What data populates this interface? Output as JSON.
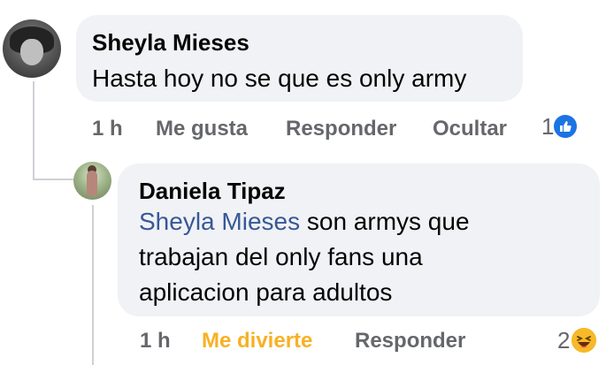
{
  "comment": {
    "author": "Sheyla Mieses",
    "text": "Hasta hoy no se que es only army",
    "time": "1 h",
    "like_label": "Me gusta",
    "reply_label": "Responder",
    "hide_label": "Ocultar",
    "reaction_count": "1",
    "reaction_icon": "like-icon",
    "reaction_color": "#1b74e4"
  },
  "reply": {
    "author": "Daniela Tipaz",
    "mention": "Sheyla Mieses",
    "line1": " son armys que",
    "line2": "trabajan del only fans una",
    "line3": "aplicacion para adultos",
    "time": "1 h",
    "reaction_label": "Me divierte",
    "reaction_label_color": "#f7b125",
    "reply_label": "Responder",
    "reaction_count": "2",
    "reaction_icon": "haha-icon"
  }
}
